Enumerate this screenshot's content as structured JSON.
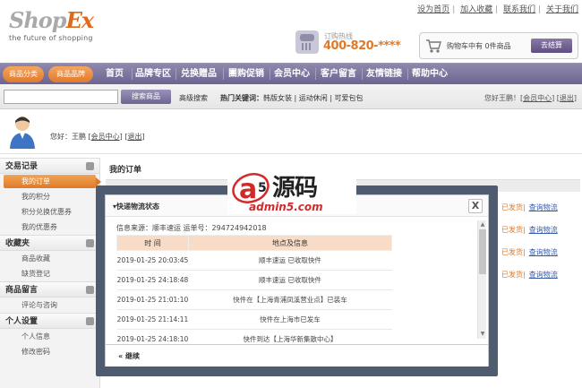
{
  "header": {
    "logo_main": "Shop",
    "logo_accent": "Ex",
    "logo_tagline": "the future of shopping",
    "top_links": [
      "设为首页",
      "加入收藏",
      "联系我们",
      "关于我们"
    ],
    "hotline_label": "订购热线",
    "hotline_number": "400-820-****",
    "cart_text": "购物车中有 0件商品",
    "checkout_label": "去结算"
  },
  "nav": {
    "pill_left": "商品分类",
    "pill_right": "商品品牌",
    "items": [
      "首页",
      "品牌专区",
      "兑换赠品",
      "團购促销",
      "会员中心",
      "客户留言",
      "友情链接",
      "帮助中心"
    ]
  },
  "search": {
    "input_value": "",
    "button": "搜索商品",
    "advanced": "高级搜索",
    "hot_label": "热门关键词：",
    "hot_words": "韩版女装 | 运动休闲 | 可爱包包",
    "welcome_prefix": "您好王鹏！",
    "welcome_link1": "会员中心",
    "welcome_link2": "退出"
  },
  "user": {
    "greeting": "您好：王鹏",
    "link1": "会员中心",
    "link2": "退出"
  },
  "sidebar": {
    "sections": [
      {
        "title": "交易记录",
        "items": [
          "我的订单",
          "我的积分",
          "积分兑换优惠券",
          "我的优惠券"
        ]
      },
      {
        "title": "收藏夹",
        "items": [
          "商品收藏",
          "缺货登记"
        ]
      },
      {
        "title": "商品留言",
        "items": [
          "评论与咨询"
        ]
      },
      {
        "title": "个人设置",
        "items": [
          "个人信息",
          "修改密码"
        ]
      }
    ],
    "active_item": "我的订单"
  },
  "main": {
    "title": "我的订单",
    "bg_links": [
      {
        "status": "已发货",
        "link": "查询物流"
      },
      {
        "status": "已发货",
        "link": "查询物流"
      },
      {
        "status": "已发货",
        "link": "查询物流"
      },
      {
        "status": "已发货",
        "link": "查询物流"
      }
    ]
  },
  "dialog": {
    "title": "快递物流状态",
    "info": "信息来源：顺丰速运 运单号：294724942018",
    "col_time": "时 间",
    "col_place": "地点及信息",
    "rows": [
      {
        "time": "2019-01-25 20:03:45",
        "info": "顺丰速运 已收取快件"
      },
      {
        "time": "2019-01-25 24:18:48",
        "info": "顺丰速运 已收取快件"
      },
      {
        "time": "2019-01-25 21:01:10",
        "info": "快件在【上海青浦凤溪营业点】已装车"
      },
      {
        "time": "2019-01-25 21:14:11",
        "info": "快件在上海市已发车"
      },
      {
        "time": "2019-01-25 24:18:10",
        "info": "快件到达【上海华新集散中心】"
      }
    ],
    "close": "X",
    "continue": "« 继续"
  },
  "watermark": {
    "title": "源码",
    "url": "admin5.com"
  }
}
